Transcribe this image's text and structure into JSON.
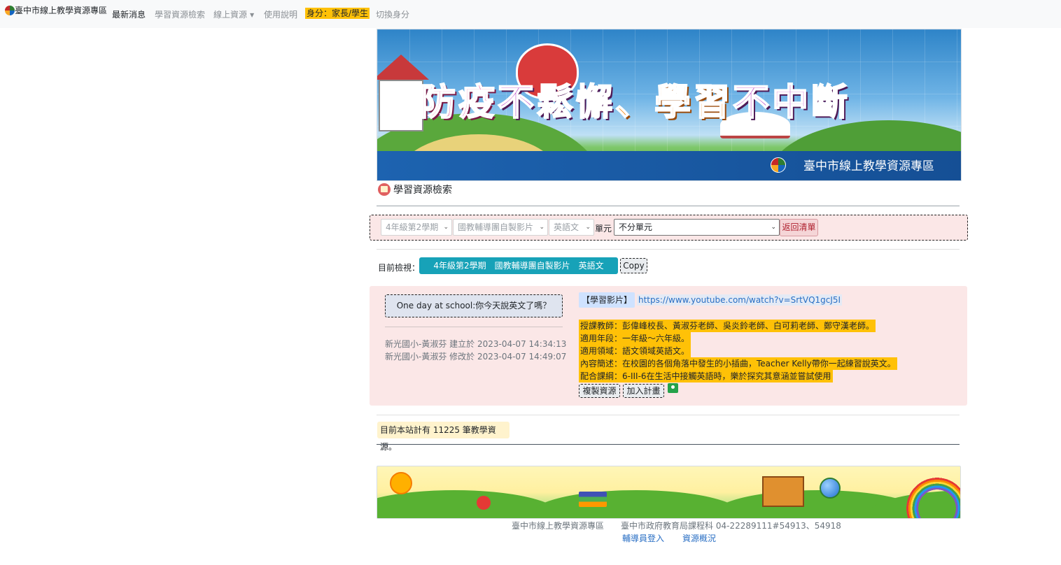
{
  "navbar": {
    "brand": "臺中市線上教學資源專區",
    "items": [
      {
        "label": "最新消息"
      },
      {
        "label": "學習資源檢索"
      },
      {
        "label": "線上資源"
      },
      {
        "label": "使用說明"
      }
    ],
    "identity": "身分：家長/學生",
    "switch_identity": "切換身分"
  },
  "banner": {
    "title_part1": "防疫",
    "title_part2": "不鬆懈",
    "title_part3": "、",
    "title_part4": "學習",
    "title_part5": "不中斷",
    "caption": "臺中市線上教學資源專區"
  },
  "section": {
    "title": "學習資源檢索"
  },
  "filter": {
    "grade_semester": "4年級第2學期",
    "category": "國教輔導團自製影片",
    "subject": "英語文",
    "unit_label": "單元",
    "unit_value": "不分單元",
    "back_button": "返回清單"
  },
  "current_view": {
    "label": "目前檢視：",
    "value": "4年級第2學期　國教輔導團自製影片　英語文",
    "copy_button": "Copy"
  },
  "resource": {
    "title": "One day at school:你今天說英文了嗎？",
    "created": "新光國小-黃淑芬 建立於 2023-04-07 14:34:13",
    "modified": "新光國小-黃淑芬 修改於 2023-04-07 14:49:07",
    "type_tag": "【學習影片】",
    "url": "https://www.youtube.com/watch?v=SrtVQ1gcJ5I",
    "teachers": "授課教師：彭偉峰校長、黃淑芬老師、吳炎鈴老師、白可莉老師、鄭守漢老師。",
    "grade_range": "適用年段：一年級～六年級。",
    "domain": "適用領域：語文領域英語文。",
    "summary": "內容簡述：在校園的各個角落中發生的小插曲，Teacher Kelly帶你一起練習說英文。",
    "curriculum": "配合課綱：6-III-6在生活中接觸英語時，樂於探究其意涵並嘗試使用",
    "copy_resource_button": "複製資源",
    "add_plan_button": "加入計畫"
  },
  "stats": {
    "text": "目前本站計有 11225 筆教學資源。"
  },
  "footer": {
    "site_name": "臺中市線上教學資源專區",
    "org_contact": "臺中市政府教育局課程科 04-22289111#54913、54918",
    "link_admin_login": "輔導員登入",
    "link_overview": "資源概況"
  },
  "colors": {
    "identity_badge": "#ffc107",
    "current_view_pill": "#17a2b8",
    "card_background": "#fbe7e7",
    "link": "#2a6fc4"
  }
}
